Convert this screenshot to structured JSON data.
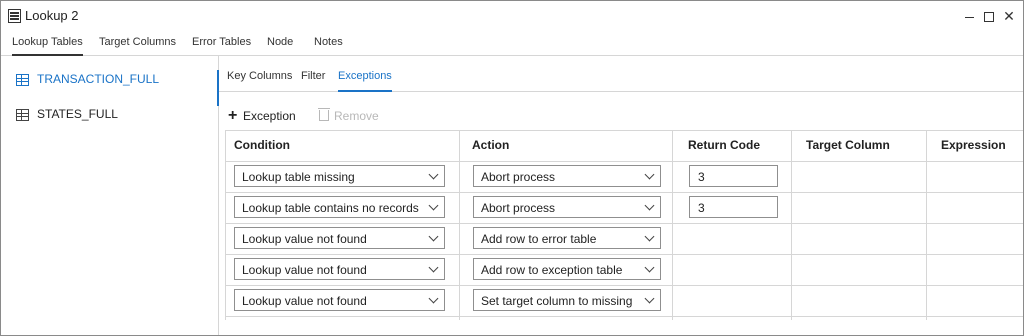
{
  "window": {
    "title": "Lookup 2"
  },
  "tabs": [
    "Lookup Tables",
    "Target Columns",
    "Error Tables",
    "Node",
    "Notes"
  ],
  "tables": [
    "TRANSACTION_FULL",
    "STATES_FULL"
  ],
  "subtabs": [
    "Key Columns",
    "Filter",
    "Exceptions"
  ],
  "toolbar": {
    "add_label": "Exception",
    "remove_label": "Remove"
  },
  "grid": {
    "headers": [
      "Condition",
      "Action",
      "Return Code",
      "Target Column",
      "Expression"
    ],
    "rows": [
      {
        "condition": "Lookup table missing",
        "action": "Abort process",
        "return_code": "3"
      },
      {
        "condition": "Lookup table contains no records",
        "action": "Abort process",
        "return_code": "3"
      },
      {
        "condition": "Lookup value not found",
        "action": "Add row to error table"
      },
      {
        "condition": "Lookup value not found",
        "action": "Add row to exception table"
      },
      {
        "condition": "Lookup value not found",
        "action": "Set target column to missing"
      }
    ]
  },
  "colors": {
    "accent": "#1a73c7",
    "border": "#d6d6d6"
  }
}
